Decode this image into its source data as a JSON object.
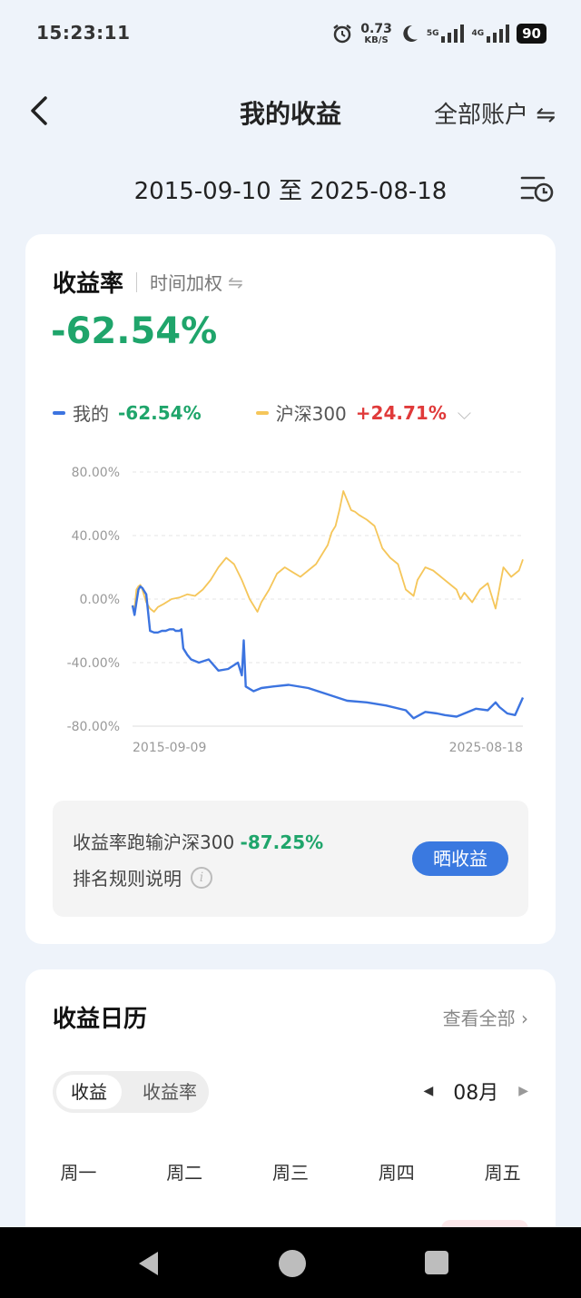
{
  "status_bar": {
    "time": "15:23:11",
    "net_speed_value": "0.73",
    "net_speed_unit": "KB/S",
    "network_5g": "5G",
    "network_4g": "4G",
    "battery": "90"
  },
  "header": {
    "title": "我的收益",
    "account_label": "全部账户 ⇋"
  },
  "date_range": "2015-09-10 至 2025-08-18",
  "return_card": {
    "title": "收益率",
    "mode_label": "时间加权",
    "total_return": "-62.54%",
    "legend": [
      {
        "name": "我的",
        "value": "-62.54%"
      },
      {
        "name": "沪深300",
        "value": "+24.71%"
      }
    ],
    "compare_text": "收益率跑输沪深300",
    "compare_value": "-87.25%",
    "rules_text": "排名规则说明",
    "share_button": "晒收益"
  },
  "chart_data": {
    "type": "line",
    "y_ticks": [
      "80.00%",
      "40.00%",
      "0.00%",
      "-40.00%",
      "-80.00%"
    ],
    "ylim": [
      -80,
      80
    ],
    "x_start_label": "2015-09-09",
    "x_end_label": "2025-08-18",
    "grid": true,
    "colors": {
      "mine": "#3c74e0",
      "hs300": "#f5c65a"
    },
    "series": [
      {
        "name": "我的",
        "x": [
          0,
          0.5,
          1.0,
          1.5,
          2.0,
          2.5,
          3.0,
          3.5,
          4.5,
          5.5,
          6.5,
          7.5,
          8.5,
          9.5,
          10.5,
          11,
          11.5,
          12,
          12.5,
          13,
          13.5,
          14,
          15,
          17,
          19.5,
          22,
          24.5,
          27,
          28,
          28.5,
          29,
          31,
          33,
          36,
          40,
          45,
          50,
          55,
          60,
          65,
          70,
          72,
          75,
          78,
          80,
          83,
          85,
          88,
          91,
          93,
          94,
          96,
          98,
          100
        ],
        "values": [
          -4,
          -10,
          -2,
          6,
          8,
          7,
          5,
          3,
          -20,
          -21,
          -21,
          -20,
          -20,
          -19,
          -19,
          -20,
          -20,
          -20,
          -19,
          -31,
          -33,
          -35,
          -38,
          -40,
          -38,
          -45,
          -44,
          -40,
          -48,
          -26,
          -55,
          -58,
          -56,
          -55,
          -54,
          -56,
          -60,
          -64,
          -65,
          -67,
          -70,
          -75,
          -71,
          -72,
          -73,
          -74,
          -72,
          -69,
          -70,
          -65,
          -68,
          -72,
          -73,
          -62
        ]
      },
      {
        "name": "沪深300",
        "x": [
          0,
          0.5,
          1.0,
          1.5,
          2.0,
          2.5,
          3.0,
          3.5,
          4.5,
          5.5,
          6.5,
          8,
          10,
          12,
          14,
          16,
          18,
          20,
          22,
          24,
          26,
          28,
          30,
          32,
          33,
          35,
          37,
          39,
          41,
          43,
          45,
          47,
          49,
          50,
          51,
          52,
          53,
          54,
          55,
          56,
          57,
          58,
          60,
          62,
          64,
          66,
          68,
          70,
          72,
          73,
          75,
          77,
          79,
          81,
          83,
          84,
          85,
          87,
          89,
          91,
          93,
          95,
          97,
          99,
          100
        ],
        "values": [
          -4,
          -6,
          6,
          8,
          9,
          6,
          2,
          -2,
          -6,
          -8,
          -5,
          -3,
          0,
          1,
          3,
          2,
          6,
          12,
          20,
          26,
          22,
          12,
          0,
          -8,
          -2,
          6,
          16,
          20,
          17,
          14,
          18,
          22,
          30,
          34,
          42,
          46,
          56,
          68,
          62,
          56,
          55,
          53,
          50,
          46,
          32,
          26,
          22,
          6,
          2,
          12,
          20,
          18,
          14,
          10,
          6,
          0,
          4,
          -2,
          6,
          10,
          -6,
          20,
          14,
          18,
          25
        ]
      }
    ]
  },
  "calendar": {
    "title": "收益日历",
    "view_all": "查看全部",
    "seg_active": "收益",
    "seg_inactive": "收益率",
    "month": "08月",
    "weekdays": [
      "周一",
      "周二",
      "周三",
      "周四",
      "周五"
    ]
  }
}
